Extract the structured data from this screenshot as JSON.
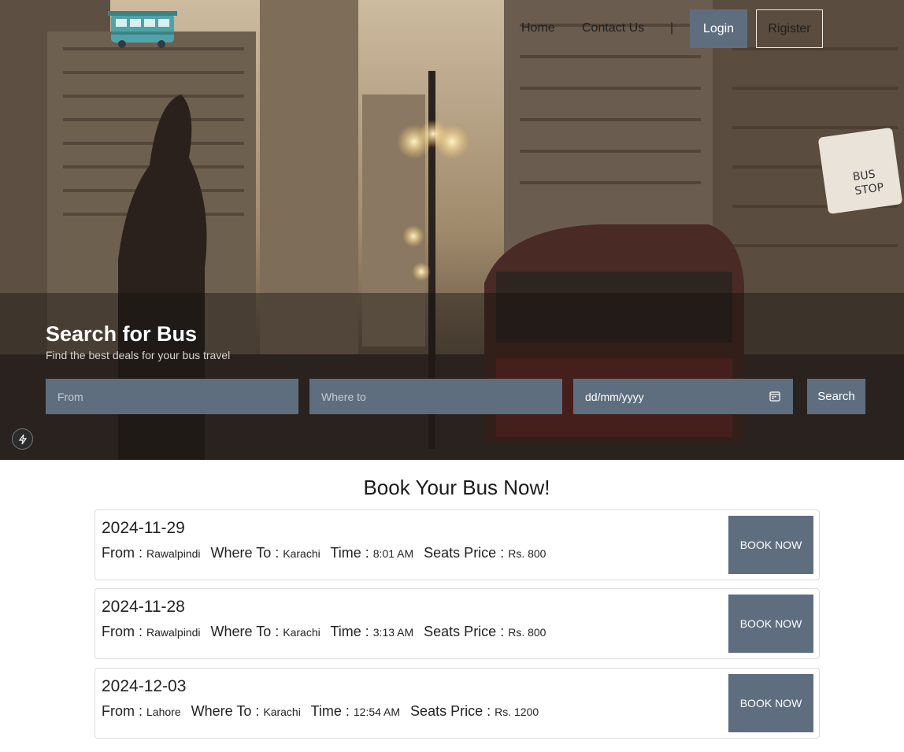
{
  "nav": {
    "home": "Home",
    "contact": "Contact Us",
    "separator": "|",
    "login": "Login",
    "register": "Rigister"
  },
  "hero": {
    "title": "Search for Bus",
    "subtitle": "Find the best deals for your bus travel",
    "from_placeholder": "From",
    "to_placeholder": "Where to",
    "date_placeholder": "dd/mm/yyyy",
    "search_label": "Search"
  },
  "section_title": "Book Your Bus Now!",
  "labels": {
    "from": "From :",
    "to": "Where To :",
    "time": "Time :",
    "price": "Seats Price :",
    "book": "BOOK NOW"
  },
  "trips": [
    {
      "date": "2024-11-29",
      "from": "Rawalpindi",
      "to": "Karachi",
      "time": "8:01 AM",
      "price": "Rs. 800"
    },
    {
      "date": "2024-11-28",
      "from": "Rawalpindi",
      "to": "Karachi",
      "time": "3:13 AM",
      "price": "Rs. 800"
    },
    {
      "date": "2024-12-03",
      "from": "Lahore",
      "to": "Karachi",
      "time": "12:54 AM",
      "price": "Rs. 1200"
    }
  ],
  "icons": {
    "logo": "bus-logo-icon",
    "calendar": "calendar-icon",
    "bolt": "bolt-icon"
  },
  "colors": {
    "accent": "#5f6e7f"
  }
}
